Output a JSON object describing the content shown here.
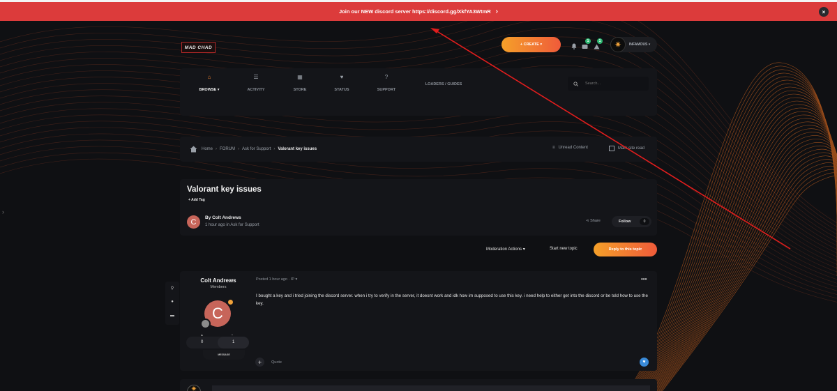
{
  "banner": {
    "text": "Join our NEW discord server https://discord.gg/XkfYA3WtmR",
    "chevron": "›",
    "close_label": "×"
  },
  "header": {
    "logo_text": "MAD CHAD",
    "create_label": "+ CREATE ▾",
    "notification_icons": [
      "bell-icon",
      "inbox-icon",
      "reports-icon"
    ],
    "inbox_count": "1",
    "reports_count": "1",
    "user_name": "INFAMOUS ▾"
  },
  "nav": {
    "items": [
      {
        "label": "BROWSE ▾",
        "icon": "home-icon",
        "active": true
      },
      {
        "label": "ACTIVITY",
        "icon": "list-icon",
        "active": false
      },
      {
        "label": "STORE",
        "icon": "store-icon",
        "active": false
      },
      {
        "label": "STATUS",
        "icon": "heart-icon",
        "active": false
      },
      {
        "label": "SUPPORT",
        "icon": "help-icon",
        "active": false
      }
    ],
    "extra_link": "LOADERS / GUIDES",
    "search_placeholder": "Search..."
  },
  "breadcrumb": {
    "items": [
      "Home",
      "FORUM",
      "Ask for Support",
      "Valorant key issues"
    ],
    "unread": "Unread Content",
    "mark_read": "Mark site read"
  },
  "topic": {
    "title": "Valorant key issues",
    "add_tag": "+ Add Tag",
    "author_initial": "C",
    "author_by": "By Colt Andrews",
    "author_meta": "1 hour ago in Ask for Support",
    "share": "Share",
    "follow": "Follow",
    "follow_count": "0"
  },
  "actions": {
    "moderation": "Moderation Actions ▾",
    "start_topic": "Start new topic",
    "reply": "Reply to this topic"
  },
  "post": {
    "poster_name": "Colt Andrews",
    "poster_group": "Members",
    "poster_initial": "C",
    "reputation": "0",
    "posts": "1",
    "message_btn": "MESSAGE",
    "meta": "Posted 1 hour ago · IP ▾",
    "body": "I bought a key and i tried joining the discord server. when i try to verify in the server, it doesnt work and idk how im supposed to use this key. i need help to either get into the discord or be told how to use the key.",
    "quote": "Quote",
    "more": "•••"
  },
  "colors": {
    "accent_orange": "#f2822f",
    "banner_red": "#dc3b3b",
    "badge_green": "#2eb872",
    "avatar_red": "#c7655a",
    "arrow_red": "#e11d1d"
  }
}
